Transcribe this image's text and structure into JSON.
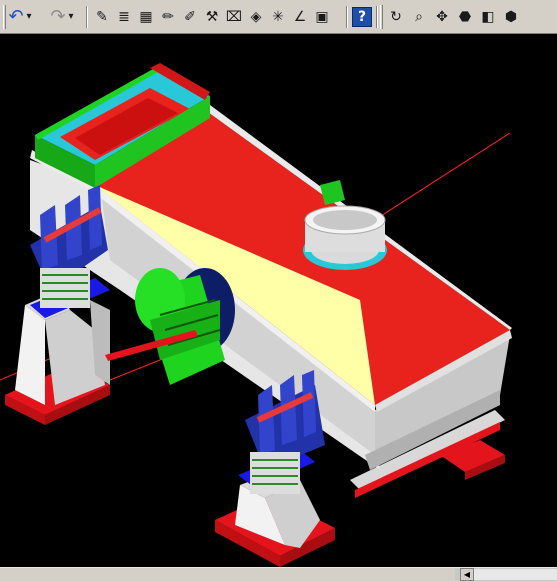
{
  "toolbar": {
    "groups": [
      {
        "name": "edit",
        "buttons": [
          {
            "name": "undo-icon",
            "glyph": "↶"
          },
          {
            "name": "undo-dropdown-icon",
            "glyph": "▾"
          },
          {
            "name": "redo-icon",
            "glyph": "↷"
          },
          {
            "name": "redo-dropdown-icon",
            "glyph": "▾"
          }
        ]
      },
      {
        "name": "tools",
        "buttons": [
          {
            "name": "sketch-icon",
            "glyph": "✎"
          },
          {
            "name": "document-list-icon",
            "glyph": "≣"
          },
          {
            "name": "table-icon",
            "glyph": "▦"
          },
          {
            "name": "pencil-icon",
            "glyph": "✏"
          },
          {
            "name": "magic-pencil-icon",
            "glyph": "✐"
          },
          {
            "name": "ruler-icon",
            "glyph": "⚒"
          },
          {
            "name": "camera-icon",
            "glyph": "⌧"
          },
          {
            "name": "cube-object-icon",
            "glyph": "◈"
          },
          {
            "name": "asterisk-icon",
            "glyph": "✳"
          },
          {
            "name": "angle-icon",
            "glyph": "∠"
          },
          {
            "name": "render-icon",
            "glyph": "▣"
          }
        ]
      },
      {
        "name": "help",
        "buttons": [
          {
            "name": "help-icon",
            "glyph": "?"
          }
        ]
      },
      {
        "name": "view",
        "buttons": [
          {
            "name": "rotate-icon",
            "glyph": "↻"
          },
          {
            "name": "zoom-icon",
            "glyph": "⌕"
          },
          {
            "name": "pan-icon",
            "glyph": "✥"
          },
          {
            "name": "shaded-view-icon",
            "glyph": "⬣"
          },
          {
            "name": "section-view-icon",
            "glyph": "◧"
          },
          {
            "name": "iso-cube-icon",
            "glyph": "⬢"
          }
        ]
      }
    ]
  },
  "scrollbar": {
    "left_arrow_glyph": "◀"
  },
  "colors": {
    "toolbar_bg": "#d4d0c8",
    "viewport_bg": "#000000",
    "screen_top": "#e8221d",
    "screen_body": "#dedede",
    "screen_wall": "#ffffa8",
    "inlet_frame": "#20c420",
    "motor": "#1fd41f",
    "spring_bracket": "#2233aa",
    "axis_red": "#ff2020",
    "ring_cyan": "#28c8d8"
  }
}
